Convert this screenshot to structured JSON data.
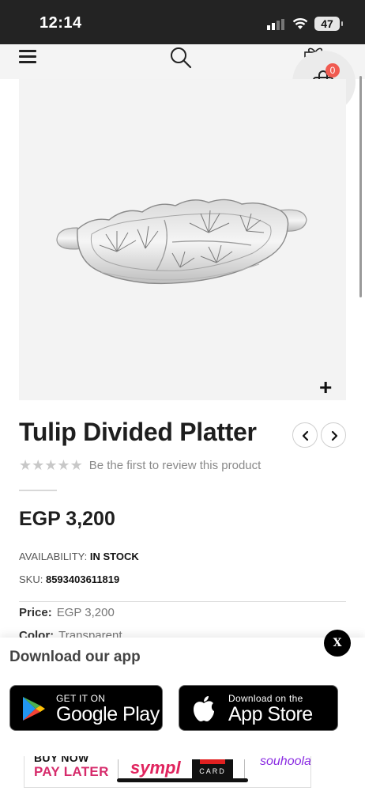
{
  "status_bar": {
    "time": "12:14",
    "battery": "47"
  },
  "header": {
    "cart_count": "0"
  },
  "product": {
    "title": "Tulip Divided Platter",
    "review_text": "Be the first to review this product",
    "price": "EGP 3,200",
    "availability_label": "AVAILABILITY:",
    "availability_value": "IN STOCK",
    "sku_label": "SKU:",
    "sku_value": "8593403611819",
    "specs": [
      {
        "label": "Price:",
        "value": "EGP 3,200"
      },
      {
        "label": "Color:",
        "value": "Transparent"
      }
    ],
    "rating_stars": 0,
    "zoom_label": "+"
  },
  "app_banner": {
    "title": "Download our app",
    "close_label": "X",
    "google_play_small": "GET IT ON",
    "google_play_big": "Google Play",
    "app_store_small": "Download on the",
    "app_store_big": "App Store"
  },
  "payment_partners": {
    "buy_now": "BUY NOW",
    "pay_later": "PAY LATER",
    "sympl": "sympl",
    "premium_card": "CARD",
    "souhoola": "souhoola"
  },
  "colors": {
    "cart_badge": "#f05a50",
    "status_bar": "#232323",
    "gallery_bg": "#f3f3f3"
  }
}
